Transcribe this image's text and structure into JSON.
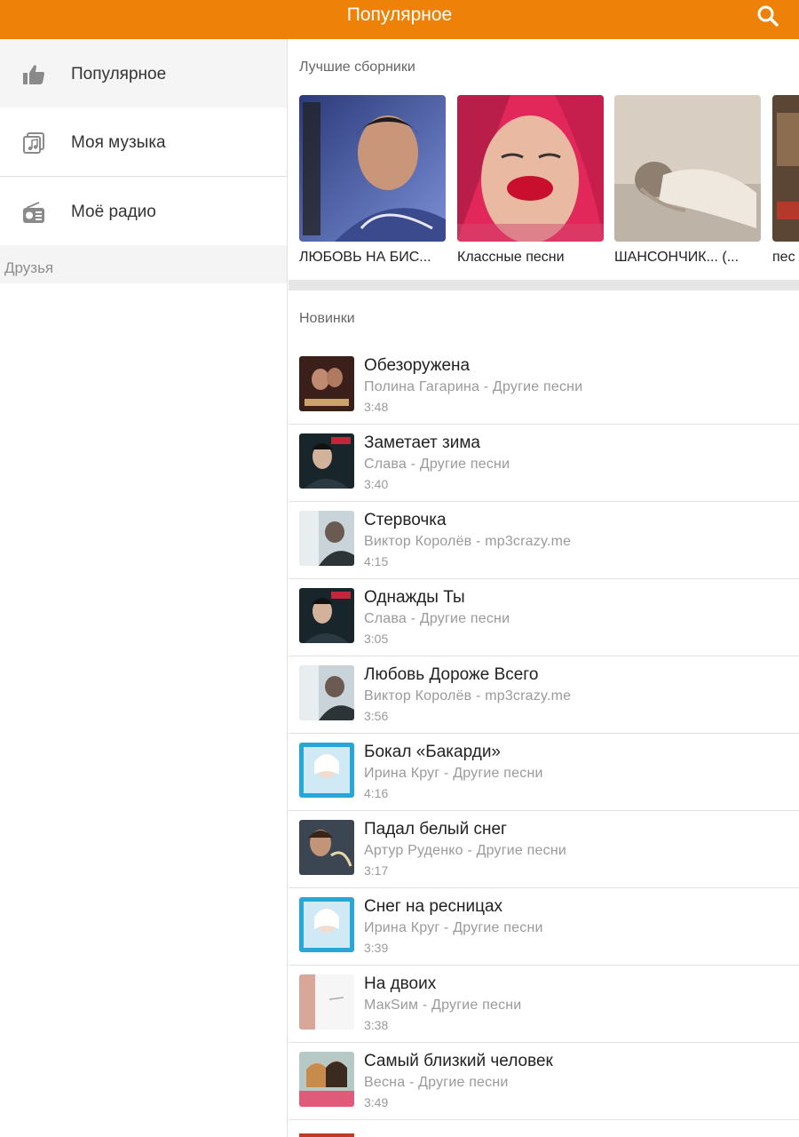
{
  "header": {
    "title": "Популярное",
    "search_icon": "search-icon"
  },
  "colors": {
    "accent": "#ee8208",
    "sidebar_active": "#f5f5f5",
    "muted_text": "#9a9a9a"
  },
  "sidebar": {
    "items": [
      {
        "label": "Популярное",
        "icon": "thumbs-up-icon",
        "active": true
      },
      {
        "label": "Моя музыка",
        "icon": "music-library-icon",
        "active": false
      },
      {
        "label": "Моё радио",
        "icon": "radio-icon",
        "active": false
      }
    ],
    "section_header": "Друзья"
  },
  "collections": {
    "title": "Лучшие сборники",
    "items": [
      {
        "title": "ЛЮБОВЬ НА БИС..."
      },
      {
        "title": "Классные песни"
      },
      {
        "title": "ШАНСОНЧИК... (..."
      },
      {
        "title": "пес"
      }
    ]
  },
  "new_releases": {
    "title": "Новинки",
    "tracks": [
      {
        "title": "Обезоружена",
        "subtitle": "Полина Гагарина - Другие песни",
        "duration": "3:48"
      },
      {
        "title": "Заметает зима",
        "subtitle": "Слава - Другие песни",
        "duration": "3:40"
      },
      {
        "title": "Стервочка",
        "subtitle": "Виктор Королёв - mp3crazy.me",
        "duration": "4:15"
      },
      {
        "title": "Однажды Ты",
        "subtitle": "Слава - Другие песни",
        "duration": "3:05"
      },
      {
        "title": "Любовь Дороже Всего",
        "subtitle": "Виктор Королёв - mp3crazy.me",
        "duration": "3:56"
      },
      {
        "title": "Бокал «Бакарди»",
        "subtitle": "Ирина Круг - Другие песни",
        "duration": "4:16"
      },
      {
        "title": "Падал белый снег",
        "subtitle": "Артур Руденко - Другие песни",
        "duration": "3:17"
      },
      {
        "title": "Снег на ресницах",
        "subtitle": "Ирина Круг - Другие песни",
        "duration": "3:39"
      },
      {
        "title": "На двоих",
        "subtitle": "МакSим - Другие песни",
        "duration": "3:38"
      },
      {
        "title": "Самый близкий человек",
        "subtitle": "Весна - Другие песни",
        "duration": "3:49"
      }
    ]
  }
}
